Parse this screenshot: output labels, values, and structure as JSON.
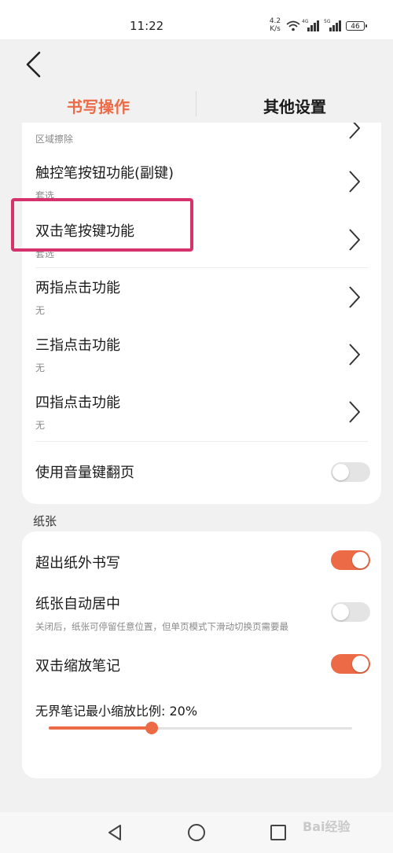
{
  "status_bar": {
    "time": "11:22",
    "net_speed": "4.2 K/s",
    "signal1_label": "4G",
    "signal2_label": "5G",
    "battery": "46"
  },
  "tabs": [
    {
      "label": "书写操作",
      "active": true
    },
    {
      "label": "其他设置",
      "active": false
    }
  ],
  "settings": {
    "partial_row_sub": "区域擦除",
    "rows": [
      {
        "title": "触控笔按钮功能(副键)",
        "value": "套选"
      },
      {
        "title": "双击笔按键功能",
        "value": "套选"
      },
      {
        "title": "两指点击功能",
        "value": "无"
      },
      {
        "title": "三指点击功能",
        "value": "无"
      },
      {
        "title": "四指点击功能",
        "value": "无"
      }
    ],
    "volume_flip": {
      "title": "使用音量键翻页",
      "enabled": false
    }
  },
  "paper": {
    "section_label": "纸张",
    "write_outside": {
      "title": "超出纸外书写",
      "enabled": true
    },
    "auto_center": {
      "title": "纸张自动居中",
      "desc": "关闭后，纸张可停留任意位置，但单页模式下滑动切换页需要最",
      "enabled": false
    },
    "double_tap_zoom": {
      "title": "双击缩放笔记",
      "enabled": true
    },
    "min_zoom_label": "无界笔记最小缩放比例: 20%",
    "min_zoom_slider_fraction": 0.34
  },
  "colors": {
    "accent": "#ec6a45",
    "highlight": "#d6336c"
  },
  "icons": [
    "back-arrow-icon",
    "chevron-right-icon",
    "wifi-icon",
    "signal-icon",
    "battery-icon",
    "nav-back-icon",
    "nav-home-icon",
    "nav-recent-icon"
  ],
  "watermark": "Bai经验"
}
